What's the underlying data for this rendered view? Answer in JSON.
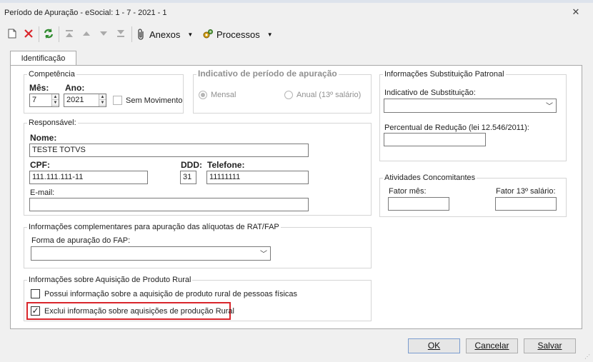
{
  "window": {
    "title": "Período de Apuração - eSocial: 1 - 7 - 2021 - 1"
  },
  "toolbar": {
    "anexos_label": "Anexos",
    "processos_label": "Processos"
  },
  "tabs": [
    {
      "label": "Identificação",
      "selected": true
    }
  ],
  "competencia": {
    "legend": "Competência",
    "mes_label": "Mês:",
    "mes_value": "7",
    "ano_label": "Ano:",
    "ano_value": "2021",
    "sem_movimento_label": "Sem Movimento",
    "sem_movimento_checked": false
  },
  "indicativo_periodo": {
    "legend": "Indicativo de período de apuração",
    "mensal_label": "Mensal",
    "anual_label": "Anual (13º salário)",
    "selected": "Mensal",
    "enabled": false
  },
  "responsavel": {
    "legend": "Responsável:",
    "nome_label": "Nome:",
    "nome_value": "TESTE TOTVS",
    "cpf_label": "CPF:",
    "cpf_value": "111.111.111-11",
    "ddd_label": "DDD:",
    "ddd_value": "31",
    "telefone_label": "Telefone:",
    "telefone_value": "11111111",
    "email_label": "E-mail:",
    "email_value": ""
  },
  "rat_fap": {
    "legend": "Informações complementares para apuração das alíquotas de RAT/FAP",
    "forma_label": "Forma de apuração do FAP:",
    "forma_value": ""
  },
  "produto_rural": {
    "legend": "Informações sobre Aquisição de Produto Rural",
    "possui_label": "Possui informação sobre a aquisição de produto rural de pessoas físicas",
    "possui_checked": false,
    "exclui_label": "Exclui informação sobre aquisições de produção Rural",
    "exclui_checked": true
  },
  "substituicao": {
    "legend": "Informações Substituição Patronal",
    "indicativo_label": "Indicativo de Substituição:",
    "indicativo_value": "",
    "percentual_label": "Percentual de Redução  (lei 12.546/2011):",
    "percentual_value": ""
  },
  "atividades": {
    "legend": "Atividades Concomitantes",
    "fator_mes_label": "Fator mês:",
    "fator_mes_value": "",
    "fator_13_label": "Fator 13º salário:",
    "fator_13_value": ""
  },
  "footer": {
    "ok_label": "OK",
    "cancelar_label": "Cancelar",
    "salvar_label": "Salvar"
  },
  "colors": {
    "highlight": "#d9262c",
    "delete_red": "#d9262c",
    "refresh_green": "#2e8b2e"
  },
  "icons": [
    "new-document-icon",
    "delete-icon",
    "refresh-icon",
    "first-record-icon",
    "previous-record-icon",
    "next-record-icon",
    "last-record-icon",
    "paperclip-icon",
    "gears-icon",
    "close-icon"
  ]
}
